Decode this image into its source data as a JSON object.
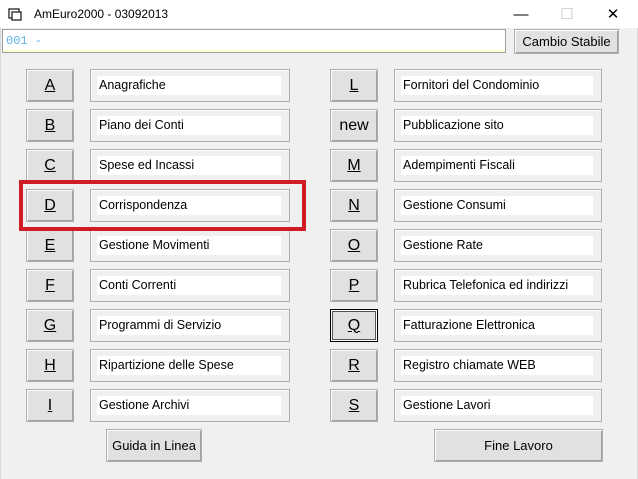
{
  "window": {
    "title": "AmEuro2000 - 03092013",
    "minimize": "—",
    "maximize": "☐",
    "close": "✕"
  },
  "toolbar": {
    "code_prefix": "001 -",
    "code_value": "",
    "cambio_label": "Cambio Stabile"
  },
  "left_menu": [
    {
      "key": "A",
      "label": "Anagrafiche"
    },
    {
      "key": "B",
      "label": "Piano dei Conti"
    },
    {
      "key": "C",
      "label": "Spese ed Incassi"
    },
    {
      "key": "D",
      "label": "Corrispondenza"
    },
    {
      "key": "E",
      "label": "Gestione Movimenti"
    },
    {
      "key": "F",
      "label": "Conti Correnti"
    },
    {
      "key": "G",
      "label": "Programmi di Servizio"
    },
    {
      "key": "H",
      "label": "Ripartizione delle Spese"
    },
    {
      "key": "I",
      "label": "Gestione Archivi"
    }
  ],
  "right_menu": [
    {
      "key": "L",
      "label": "Fornitori del Condominio"
    },
    {
      "key": "new",
      "label": "Pubblicazione sito"
    },
    {
      "key": "M",
      "label": "Adempimenti Fiscali"
    },
    {
      "key": "N",
      "label": "Gestione Consumi"
    },
    {
      "key": "O",
      "label": "Gestione Rate"
    },
    {
      "key": "P",
      "label": "Rubrica Telefonica ed indirizzi"
    },
    {
      "key": "Q",
      "label": "Fatturazione Elettronica"
    },
    {
      "key": "R",
      "label": "Registro chiamate WEB"
    },
    {
      "key": "S",
      "label": "Gestione Lavori"
    }
  ],
  "footer": {
    "help_label": "Guida in Linea",
    "exit_label": "Fine Lavoro"
  },
  "colors": {
    "highlight": "#d01c24",
    "code_prefix": "#5bb4e6"
  }
}
